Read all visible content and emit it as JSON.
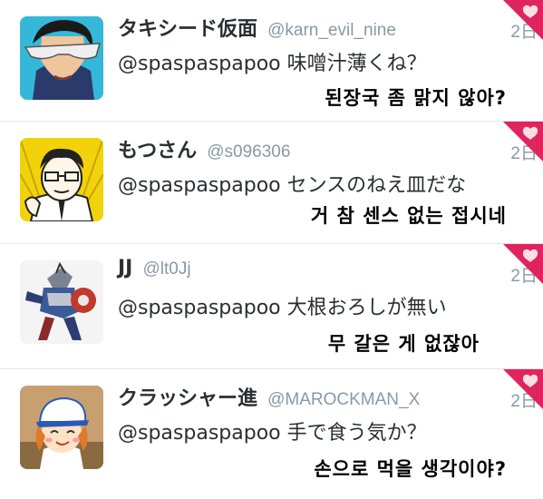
{
  "tweets": [
    {
      "display_name": "タキシード仮面",
      "handle": "@karn_evil_nine",
      "timestamp": "2日",
      "mention": "@spaspaspapoo",
      "text": "味噌汁薄くね？",
      "translation": "된장국 좀 맑지 않아?",
      "avatar_icon": "anime-man-sunglasses-avatar",
      "favorited": true
    },
    {
      "display_name": "もつさん",
      "handle": "@s096306",
      "timestamp": "2日",
      "mention": "@spaspaspapoo",
      "text": "センスのねえ皿だな",
      "translation": "거 참 센스 없는 접시네",
      "avatar_icon": "manga-man-glasses-avatar",
      "favorited": true
    },
    {
      "display_name": "JJ",
      "handle": "@lt0Jj",
      "timestamp": "2日",
      "mention": "@spaspaspapoo",
      "text": "大根おろしが無い",
      "translation": "무 갈은 게 없잖아",
      "avatar_icon": "robot-figure-avatar",
      "favorited": true
    },
    {
      "display_name": "クラッシャー進",
      "handle": "@MAROCKMAN_X",
      "timestamp": "2日",
      "mention": "@spaspaspapoo",
      "text": "手で食う気か？",
      "translation": "손으로 먹을 생각이야?",
      "avatar_icon": "baseball-kid-avatar",
      "favorited": true
    }
  ],
  "colors": {
    "name": "#292f33",
    "meta": "#8899a6",
    "favorite_corner": "#e0245e",
    "divider": "#e3e5e8"
  }
}
